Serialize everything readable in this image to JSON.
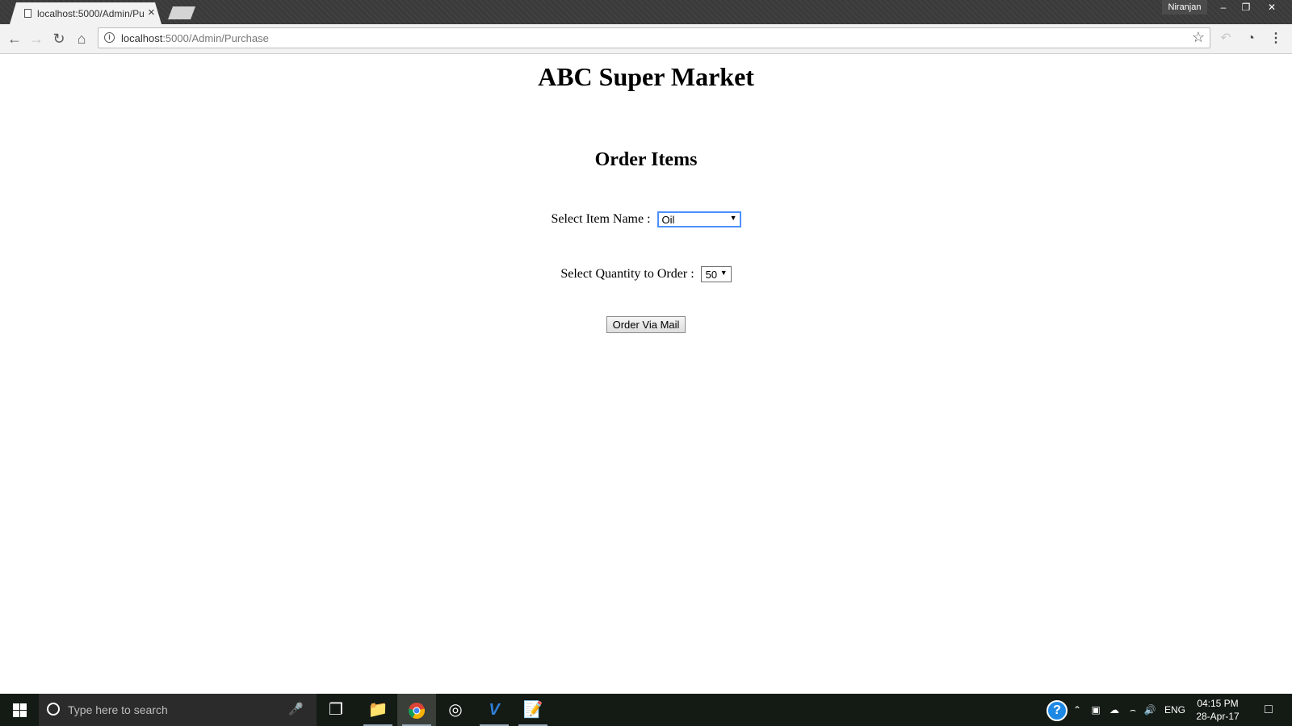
{
  "browser": {
    "tab_title": "localhost:5000/Admin/Pu",
    "tab_close": "×",
    "profile_name": "Niranjan",
    "url_host": "localhost",
    "url_path": ":5000/Admin/Purchase",
    "icons": [
      "back-icon",
      "forward-icon",
      "reload-icon",
      "home-icon",
      "info-icon",
      "star-icon",
      "speed-icon",
      "menu-icon"
    ]
  },
  "page": {
    "site_title": "ABC Super Market",
    "section_title": "Order Items",
    "item_label": "Select Item Name :",
    "item_value": "Oil",
    "quantity_label": "Select Quantity to Order :",
    "quantity_value": "50",
    "submit_label": "Order Via Mail"
  },
  "taskbar": {
    "search_placeholder": "Type here to search",
    "language": "ENG",
    "time": "04:15 PM",
    "date": "28-Apr-17"
  },
  "colors": {
    "chrome_bg": "#f2f2f2",
    "titlebar_bg": "#3a3a3a",
    "taskbar_bg": "#141a14",
    "focus_blue": "#4d90fe",
    "help_blue": "#1e88e5"
  }
}
